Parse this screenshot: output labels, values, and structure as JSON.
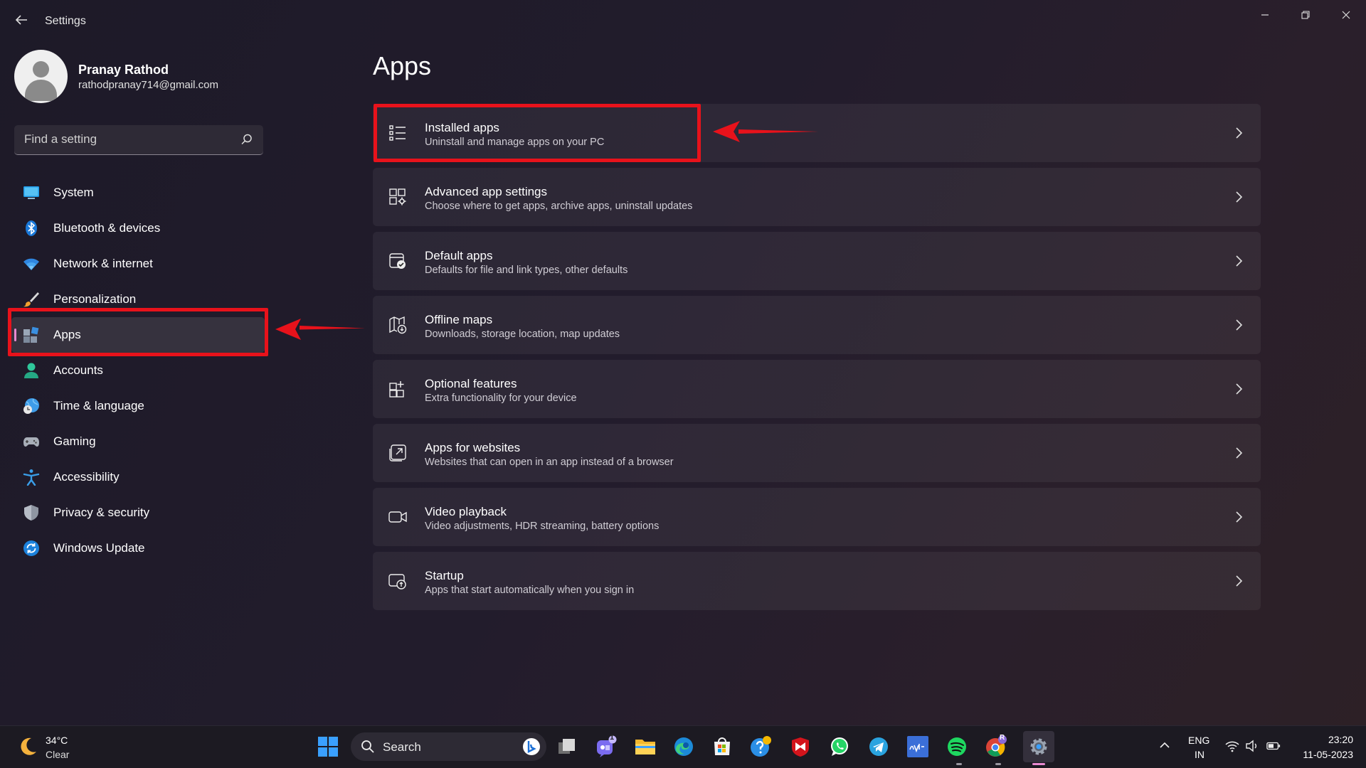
{
  "window": {
    "title": "Settings",
    "controls": {
      "minimize": "minimize-icon",
      "maximize": "restore-icon",
      "close": "close-icon"
    }
  },
  "profile": {
    "name": "Pranay Rathod",
    "email": "rathodpranay714@gmail.com"
  },
  "search": {
    "placeholder": "Find a setting"
  },
  "sidebar": {
    "items": [
      {
        "label": "System",
        "icon": "monitor-icon"
      },
      {
        "label": "Bluetooth & devices",
        "icon": "bluetooth-icon"
      },
      {
        "label": "Network & internet",
        "icon": "wifi-icon"
      },
      {
        "label": "Personalization",
        "icon": "brush-icon"
      },
      {
        "label": "Apps",
        "icon": "apps-icon",
        "active": true
      },
      {
        "label": "Accounts",
        "icon": "person-icon"
      },
      {
        "label": "Time & language",
        "icon": "globe-clock-icon"
      },
      {
        "label": "Gaming",
        "icon": "gamepad-icon"
      },
      {
        "label": "Accessibility",
        "icon": "accessibility-icon"
      },
      {
        "label": "Privacy & security",
        "icon": "shield-icon"
      },
      {
        "label": "Windows Update",
        "icon": "update-icon"
      }
    ]
  },
  "main": {
    "title": "Apps",
    "cards": [
      {
        "title": "Installed apps",
        "subtitle": "Uninstall and manage apps on your PC",
        "icon": "list-icon"
      },
      {
        "title": "Advanced app settings",
        "subtitle": "Choose where to get apps, archive apps, uninstall updates",
        "icon": "app-settings-icon"
      },
      {
        "title": "Default apps",
        "subtitle": "Defaults for file and link types, other defaults",
        "icon": "default-apps-icon"
      },
      {
        "title": "Offline maps",
        "subtitle": "Downloads, storage location, map updates",
        "icon": "map-icon"
      },
      {
        "title": "Optional features",
        "subtitle": "Extra functionality for your device",
        "icon": "add-feature-icon"
      },
      {
        "title": "Apps for websites",
        "subtitle": "Websites that can open in an app instead of a browser",
        "icon": "open-link-icon"
      },
      {
        "title": "Video playback",
        "subtitle": "Video adjustments, HDR streaming, battery options",
        "icon": "video-icon"
      },
      {
        "title": "Startup",
        "subtitle": "Apps that start automatically when you sign in",
        "icon": "startup-icon"
      }
    ]
  },
  "taskbar": {
    "weather": {
      "temp": "34°C",
      "desc": "Clear"
    },
    "search_label": "Search",
    "chat_badge": "1",
    "chrome_badge": "R",
    "lang_line1": "ENG",
    "lang_line2": "IN",
    "time": "23:20",
    "date": "11-05-2023"
  },
  "colors": {
    "highlight_red": "#e8121b",
    "active_indicator": "#e889d0",
    "accent_blue": "#3aa0ff"
  }
}
